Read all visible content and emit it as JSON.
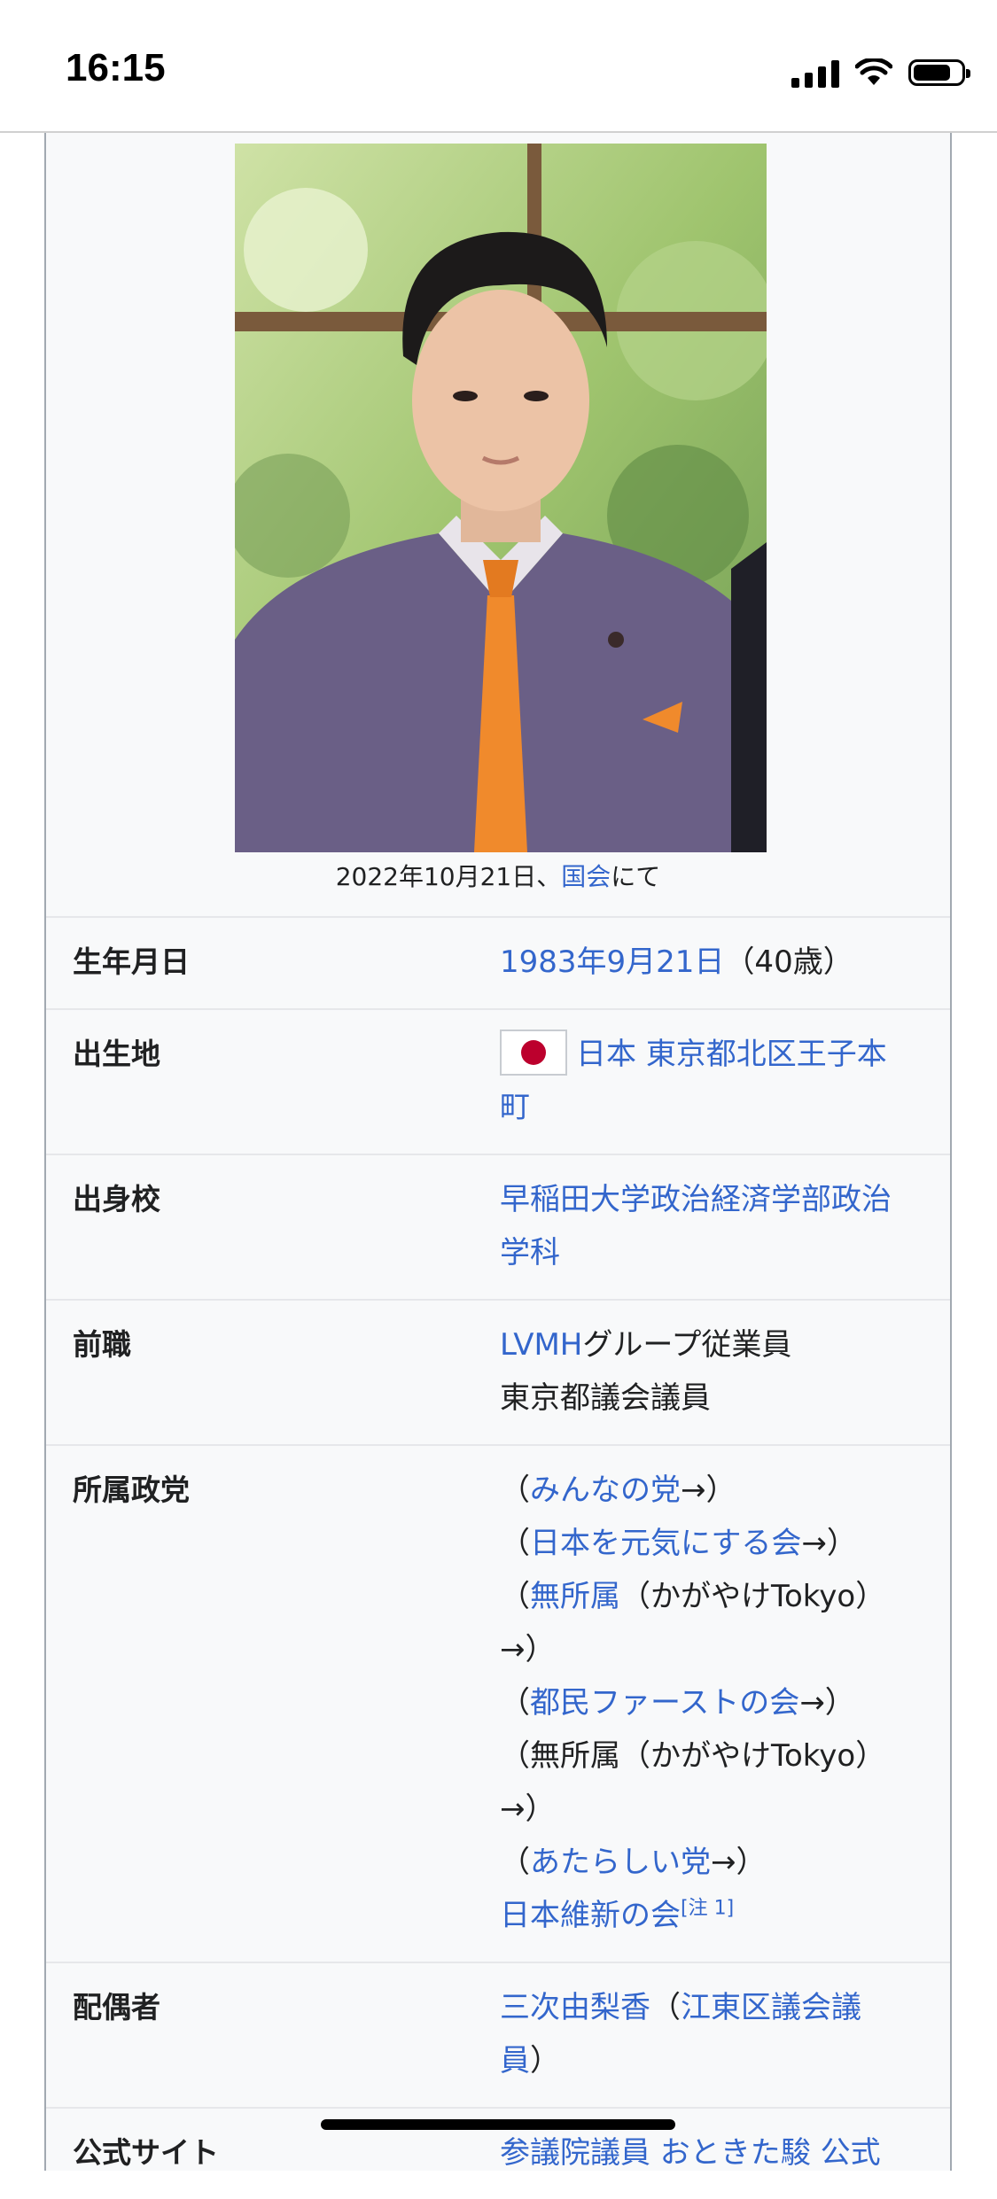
{
  "status": {
    "time": "16:15"
  },
  "infobox": {
    "caption": {
      "date_text": "2022年10月21日、",
      "place_link": "国会",
      "suffix": "にて"
    },
    "birth_date": {
      "label": "生年月日",
      "link": "1983年9月21日",
      "age": "（40歳）"
    },
    "birth_place": {
      "label": "出生地",
      "country": "日本",
      "place": "東京都北区王子本町",
      "flag_icon": "japan-flag-icon"
    },
    "alma_mater": {
      "label": "出身校",
      "value": "早稲田大学政治経済学部政治学科"
    },
    "previous_job": {
      "label": "前職",
      "company_link": "LVMH",
      "company_suffix": "グループ従業員",
      "line2": "東京都議会議員"
    },
    "party": {
      "label": "所属政党",
      "items": [
        {
          "open": "（",
          "link": "みんなの党",
          "close": "→）"
        },
        {
          "open": "（",
          "link": "日本を元気にする会",
          "close": "→）"
        },
        {
          "open": "（",
          "link": "無所属",
          "close": "（かがやけTokyo）→）"
        },
        {
          "open": "（",
          "link": "都民ファーストの会",
          "close": "→）"
        },
        {
          "open": "（",
          "text": "無所属（かがやけTokyo）→）"
        },
        {
          "open": "（",
          "link": "あたらしい党",
          "close": "→）"
        },
        {
          "link": "日本維新の会",
          "note": "[注 1]"
        }
      ]
    },
    "spouse": {
      "label": "配偶者",
      "name_link": "三次由梨香",
      "open": "（",
      "role_link": "江東区議会議員",
      "close": "）"
    },
    "website": {
      "label": "公式サイト",
      "value": "参議院議員 おときた駿 公式"
    }
  }
}
